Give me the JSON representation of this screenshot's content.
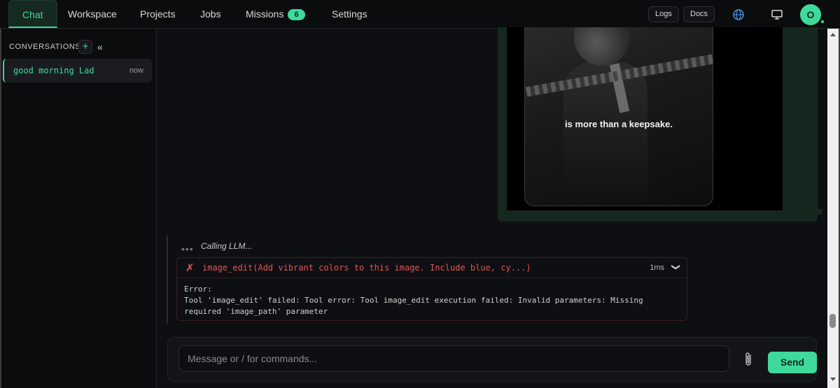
{
  "nav": {
    "tabs": [
      {
        "label": "Chat"
      },
      {
        "label": "Workspace"
      },
      {
        "label": "Projects"
      },
      {
        "label": "Jobs"
      },
      {
        "label": "Missions",
        "badge": "6"
      },
      {
        "label": "Settings"
      }
    ],
    "logs_label": "Logs",
    "docs_label": "Docs",
    "avatar_initial": "O"
  },
  "sidebar": {
    "title": "CONVERSATIONS",
    "add_label": "+",
    "collapse_label": "«",
    "conversations": [
      {
        "name": "good morning Lad",
        "time": "now"
      }
    ]
  },
  "message": {
    "image_caption": "is more than a keepsake."
  },
  "status": {
    "dots": "•••",
    "text": "Calling LLM..."
  },
  "tool_call": {
    "icon": "✗",
    "name": "image_edit(Add vibrant colors to this image. Include blue, cy...)",
    "duration": "1ms",
    "chevron": "❯",
    "error_title": "Error:",
    "error_message": "Tool 'image_edit' failed: Tool error: Tool image_edit execution failed: Invalid parameters: Missing required 'image_path' parameter"
  },
  "composer": {
    "placeholder": "Message or / for commands...",
    "send_label": "Send"
  },
  "colors": {
    "accent": "#3fd99b",
    "error": "#e05555",
    "background": "#0e0f12"
  }
}
